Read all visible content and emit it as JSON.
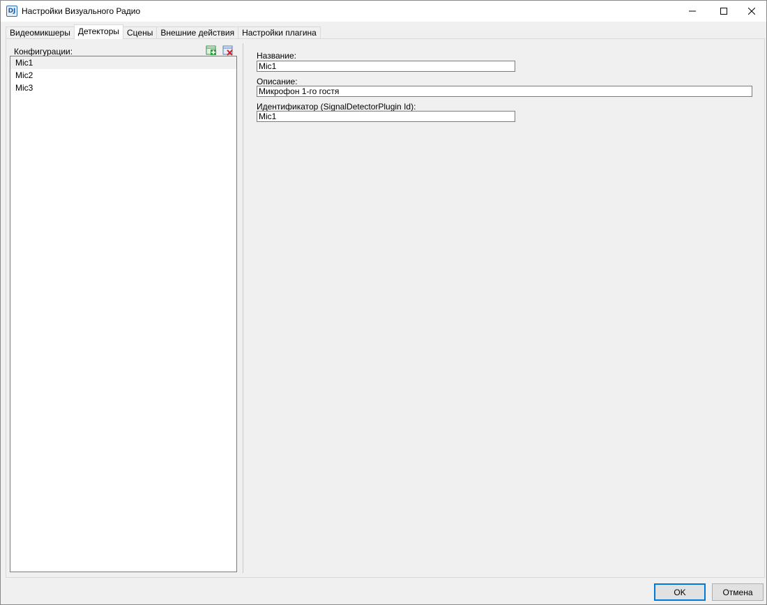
{
  "window": {
    "title": "Настройки Визуального Радио",
    "icon": "radio-app-icon",
    "icon_glyph": "DJ"
  },
  "tabs": [
    {
      "label": "Видеомикшеры",
      "active": false
    },
    {
      "label": "Детекторы",
      "active": true
    },
    {
      "label": "Сцены",
      "active": false
    },
    {
      "label": "Внешние действия",
      "active": false
    },
    {
      "label": "Настройки плагина",
      "active": false
    }
  ],
  "configurations": {
    "label": "Конфигурации:",
    "items": [
      "Mic1",
      "Mic2",
      "Mic3"
    ],
    "selected_index": 0
  },
  "form": {
    "name_label": "Название:",
    "name_value": "Mic1",
    "description_label": "Описание:",
    "description_value": "Микрофон 1-го гостя",
    "id_label": "Идентификатор (SignalDetectorPlugin Id):",
    "id_value": "Mic1"
  },
  "buttons": {
    "ok": "OK",
    "cancel": "Отмена"
  },
  "colors": {
    "accent": "#0078d7",
    "add_icon": "#2e9e3e",
    "delete_icon": "#d42020"
  }
}
